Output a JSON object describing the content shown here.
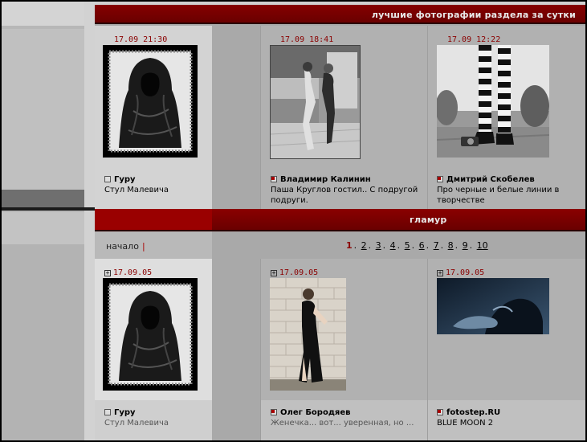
{
  "section_best": {
    "title": "лучшие фотографии раздела за сутки",
    "photos": [
      {
        "date": "17.09 21:30",
        "author": "Гуру",
        "desc": "Стул Малевича"
      },
      {
        "date": "17.09 18:41",
        "author": "Владимир Калинин",
        "desc": "Паша Круглов гостил.. С подругой подруги."
      },
      {
        "date": "17.09 12:22",
        "author": "Дмитрий Скобелев",
        "desc": "Про черные и белые линии в творчестве"
      }
    ]
  },
  "section_glamour": {
    "title": "гламур",
    "pager": {
      "start_label": "начало",
      "separator": "|",
      "pages": [
        "1",
        "2",
        "3",
        "4",
        "5",
        "6",
        "7",
        "8",
        "9",
        "10"
      ],
      "current": "1"
    },
    "photos": [
      {
        "date": "17.09.05",
        "author": "Гуру",
        "desc": "Стул Малевича"
      },
      {
        "date": "17.09.05",
        "author": "Олег Бородяев",
        "desc": "Женечка... вот... уверенная, но ..."
      },
      {
        "date": "17.09.05",
        "author": "fotostep.RU",
        "desc": "BLUE MOON 2"
      }
    ]
  },
  "colors": {
    "accent_red": "#8a0000",
    "header_text": "#e8e8e8",
    "background_grey": "#a9a9a9"
  }
}
